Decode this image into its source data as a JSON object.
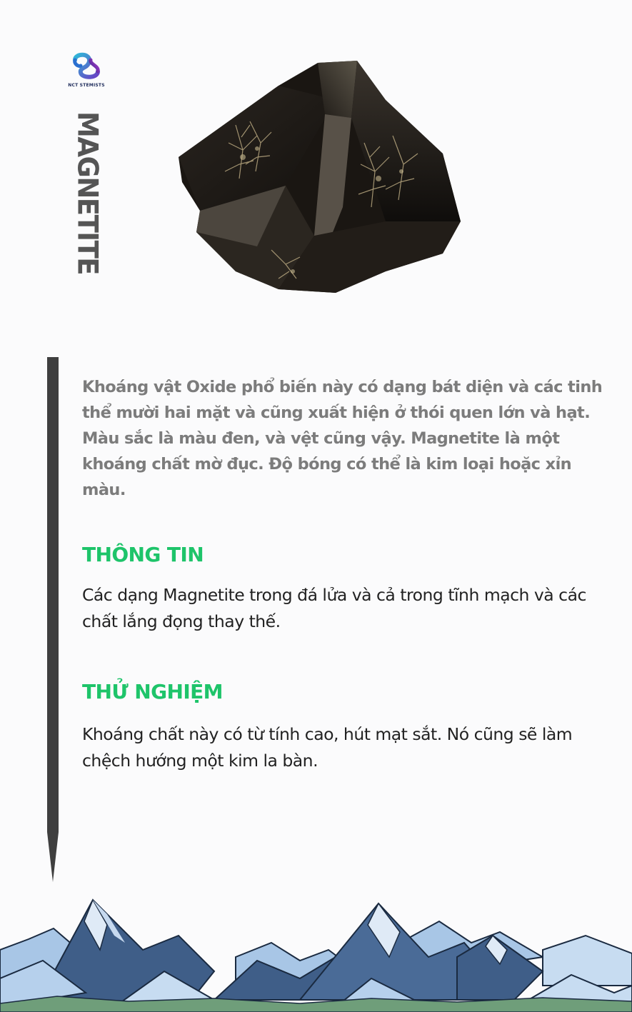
{
  "brand": {
    "logo_icon": "infinity-loop-logo",
    "logo_text": "NCT STEMISTS"
  },
  "title": "MAGNETITE",
  "intro": "Khoáng vật Oxide phổ biến này có dạng bát diện và các tinh thể mười hai mặt và cũng xuất hiện ở thói quen lớn và hạt. Màu sắc là màu đen, và vệt cũng vậy. Magnetite là một khoáng chất mờ đục. Độ bóng có thể là kim loại hoặc xỉn màu.",
  "sections": [
    {
      "heading": "THÔNG TIN",
      "text": "Các dạng Magnetite trong đá lửa và cả trong tĩnh mạch và các chất lắng đọng thay thế."
    },
    {
      "heading": "THỬ NGHIỆM",
      "text": "Khoáng chất này có từ tính cao, hút mạt sắt. Nó cũng sẽ làm chệch hướng một kim la bàn."
    }
  ],
  "colors": {
    "heading": "#1ec46a",
    "intro_text": "#7c7c7c",
    "body_text": "#222222",
    "title": "#555555",
    "bar": "#3f3f3f",
    "background": "#fbfbfc"
  }
}
